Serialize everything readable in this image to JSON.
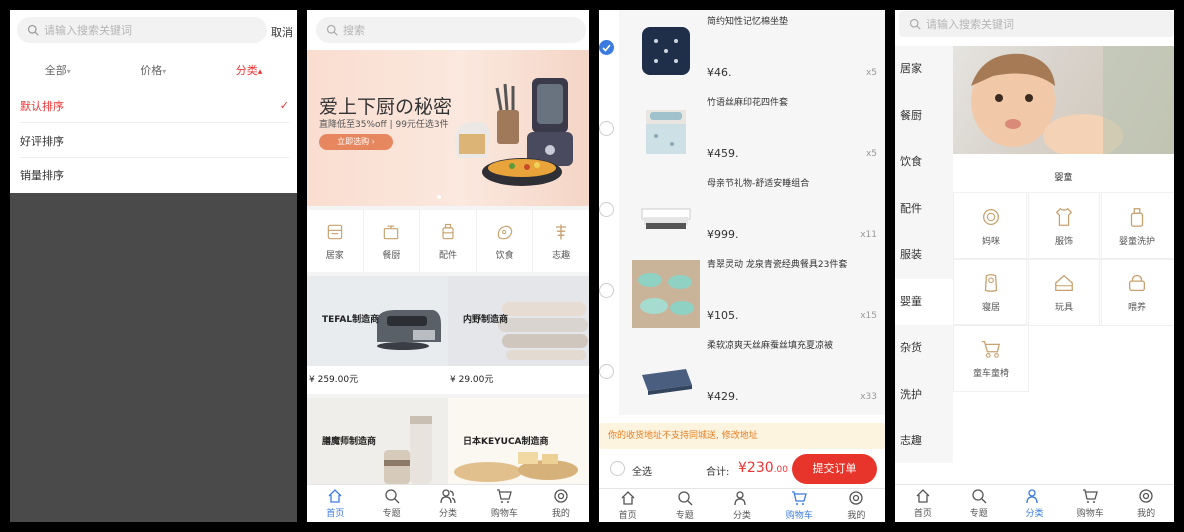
{
  "colors": {
    "accent_red": "#e33333",
    "accent_blue": "#3b7be0",
    "icon_tan": "#c7a16f"
  },
  "panel1": {
    "search_placeholder": "请输入搜索关键词",
    "cancel": "取消",
    "filters": [
      {
        "label": "全部",
        "arrow": "▾"
      },
      {
        "label": "价格",
        "arrow": "▾"
      },
      {
        "label": "分类",
        "arrow": "▴"
      }
    ],
    "sort_options": [
      {
        "label": "默认排序",
        "selected": true,
        "check": "✓"
      },
      {
        "label": "好评排序"
      },
      {
        "label": "销量排序"
      }
    ]
  },
  "panel2": {
    "search_placeholder": "搜索",
    "banner": {
      "title": "爱上下厨の秘密",
      "subtitle": "直降低至35%off | 99元任选3件",
      "button": "立即选购 ›"
    },
    "categories": [
      {
        "label": "居家",
        "icon": "home-icon"
      },
      {
        "label": "餐厨",
        "icon": "pot-icon"
      },
      {
        "label": "配件",
        "icon": "luggage-icon"
      },
      {
        "label": "饮食",
        "icon": "food-icon"
      },
      {
        "label": "志趣",
        "icon": "interest-icon"
      }
    ],
    "products": [
      {
        "name": "TEFAL制造商",
        "price": "¥ 259.00元"
      },
      {
        "name": "内野制造商",
        "price": "¥ 29.00元"
      },
      {
        "name": "膳魔师制造商"
      },
      {
        "name": "日本KEYUCA制造商"
      }
    ],
    "tabs": [
      "首页",
      "专题",
      "分类",
      "购物车",
      "我的"
    ]
  },
  "panel3": {
    "items": [
      {
        "name": "简约知性记忆棉坐垫",
        "price": "¥46.",
        "qty": "x5",
        "checked": true
      },
      {
        "name": "竹语丝麻印花四件套",
        "price": "¥459.",
        "qty": "x5",
        "checked": false
      },
      {
        "name": "母亲节礼物-舒适安睡组合",
        "price": "¥999.",
        "qty": "x11",
        "checked": false
      },
      {
        "name": "青翠灵动 龙泉青瓷经典餐具23件套",
        "price": "¥105.",
        "qty": "x15",
        "checked": false
      },
      {
        "name": "柔软凉爽天丝麻蚕丝填充夏凉被",
        "price": "¥429.",
        "qty": "x33",
        "checked": false
      }
    ],
    "address_notice": "你的收货地址不支持同城送, 修改地址",
    "select_all": "全选",
    "total_label": "合计:",
    "total_value": "¥230",
    "total_cents": ".00",
    "submit": "提交订单",
    "tabs": [
      "首页",
      "专题",
      "分类",
      "购物车",
      "我的"
    ]
  },
  "panel4": {
    "search_placeholder": "请输入搜索关键词",
    "nav": [
      "居家",
      "餐厨",
      "饮食",
      "配件",
      "服装",
      "婴童",
      "杂货",
      "洗护",
      "志趣"
    ],
    "section_title": "婴童",
    "subcats": [
      {
        "label": "妈咪",
        "icon": "mommy-icon"
      },
      {
        "label": "服饰",
        "icon": "clothes-icon"
      },
      {
        "label": "婴童洗护",
        "icon": "bottle-icon"
      },
      {
        "label": "寝居",
        "icon": "sleep-icon"
      },
      {
        "label": "玩具",
        "icon": "toy-icon"
      },
      {
        "label": "喂养",
        "icon": "feeding-icon"
      },
      {
        "label": "童车童椅",
        "icon": "stroller-icon"
      }
    ],
    "tabs": [
      "首页",
      "专题",
      "分类",
      "购物车",
      "我的"
    ]
  }
}
